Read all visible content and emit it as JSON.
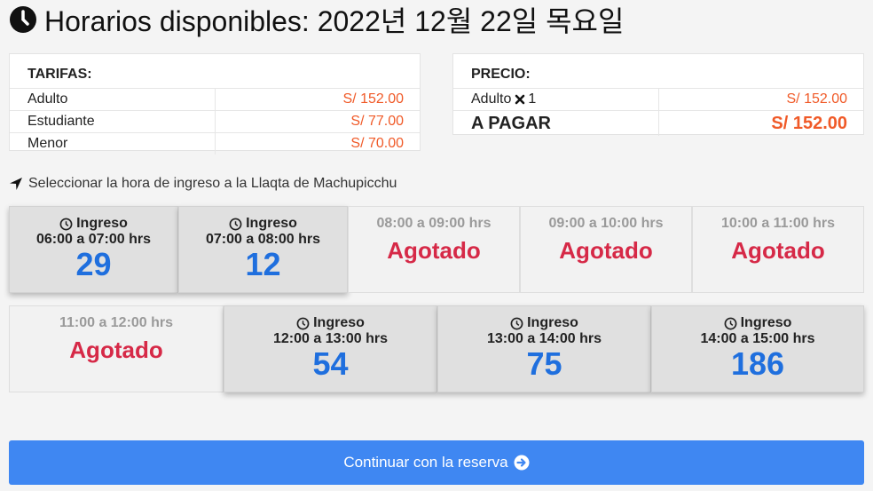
{
  "header": {
    "title": "Horarios disponibles: 2022년 12월 22일 목요일"
  },
  "tarifas": {
    "heading": "TARIFAS:",
    "rows": [
      {
        "label": "Adulto",
        "price": "S/ 152.00"
      },
      {
        "label": "Estudiante",
        "price": "S/ 77.00"
      },
      {
        "label": "Menor",
        "price": "S/ 70.00"
      }
    ]
  },
  "precio": {
    "heading": "PRECIO:",
    "line_label": "Adulto",
    "line_multiplier": "1",
    "line_price": "S/ 152.00",
    "total_label": "A PAGAR",
    "total_price": "S/ 152.00"
  },
  "select_label": "Seleccionar la hora de ingreso a la Llaqta de Machupicchu",
  "slots": [
    {
      "status": "available",
      "ingreso": "Ingreso",
      "time": "06:00 a 07:00 hrs",
      "count": "29"
    },
    {
      "status": "available",
      "ingreso": "Ingreso",
      "time": "07:00 a 08:00 hrs",
      "count": "12"
    },
    {
      "status": "sold",
      "time": "08:00 a 09:00 hrs",
      "label": "Agotado"
    },
    {
      "status": "sold",
      "time": "09:00 a 10:00 hrs",
      "label": "Agotado"
    },
    {
      "status": "sold",
      "time": "10:00 a 11:00 hrs",
      "label": "Agotado"
    },
    {
      "status": "sold",
      "time": "11:00 a 12:00 hrs",
      "label": "Agotado"
    },
    {
      "status": "available",
      "ingreso": "Ingreso",
      "time": "12:00 a 13:00 hrs",
      "count": "54"
    },
    {
      "status": "available",
      "ingreso": "Ingreso",
      "time": "13:00 a 14:00 hrs",
      "count": "75"
    },
    {
      "status": "available",
      "ingreso": "Ingreso",
      "time": "14:00 a 15:00 hrs",
      "count": "186"
    }
  ],
  "continue_button": {
    "label": "Continuar con la reserva"
  },
  "colors": {
    "accent": "#3f87f2",
    "price": "#f05a28",
    "soldout": "#d62947",
    "count": "#1f6fde"
  }
}
